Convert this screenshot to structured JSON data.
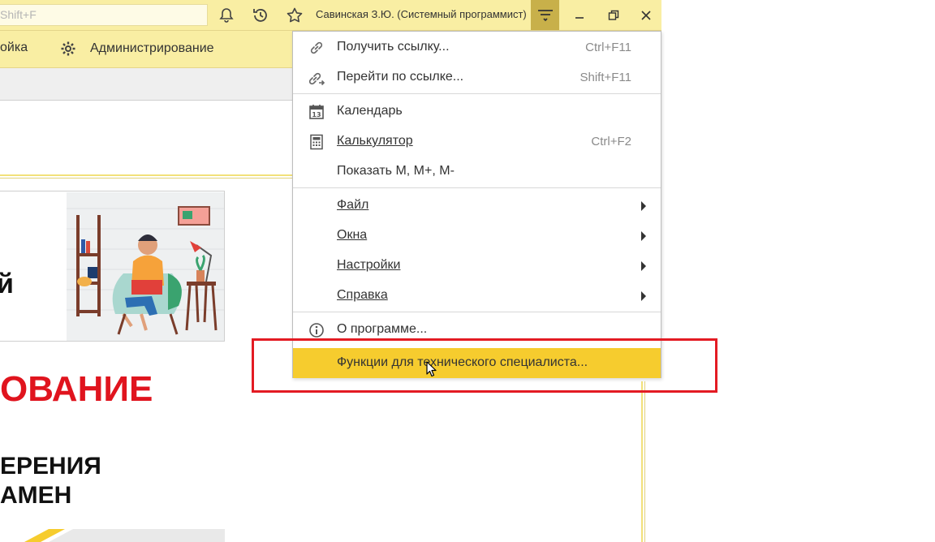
{
  "titlebar": {
    "search_placeholder": "Shift+F",
    "user_name": "Савинская З.Ю. (Системный программист)",
    "icons": [
      "bell-icon",
      "history-icon",
      "star-icon",
      "main-menu-icon",
      "minimize-icon",
      "restore-icon",
      "close-icon"
    ]
  },
  "sections": {
    "item1": "ойка",
    "item2": "Администрирование"
  },
  "content": {
    "banner_fragment": "й",
    "promo_red": "ОВАНИЕ",
    "promo_line1": "ЕРЕНИЯ",
    "promo_line2": "АМЕН"
  },
  "menu": {
    "get_link": {
      "label": "Получить ссылку...",
      "shortcut": "Ctrl+F11"
    },
    "go_link": {
      "label": "Перейти по ссылке...",
      "shortcut": "Shift+F11"
    },
    "calendar": {
      "label": "Календарь",
      "icon_num": "13"
    },
    "calculator": {
      "label": "Калькулятор",
      "shortcut": "Ctrl+F2"
    },
    "show_m": {
      "label": "Показать М, М+, М-"
    },
    "file": {
      "label": "Файл"
    },
    "windows": {
      "label": "Окна"
    },
    "settings": {
      "label": "Настройки"
    },
    "help": {
      "label": "Справка"
    },
    "about": {
      "label": "О программе..."
    },
    "tech": {
      "label": "Функции для технического специалиста..."
    }
  },
  "colors": {
    "panel_yellow": "#f9eea3",
    "highlight": "#f6cc2e",
    "annotation_red": "#e31b23",
    "promo_red": "#e0141e"
  }
}
